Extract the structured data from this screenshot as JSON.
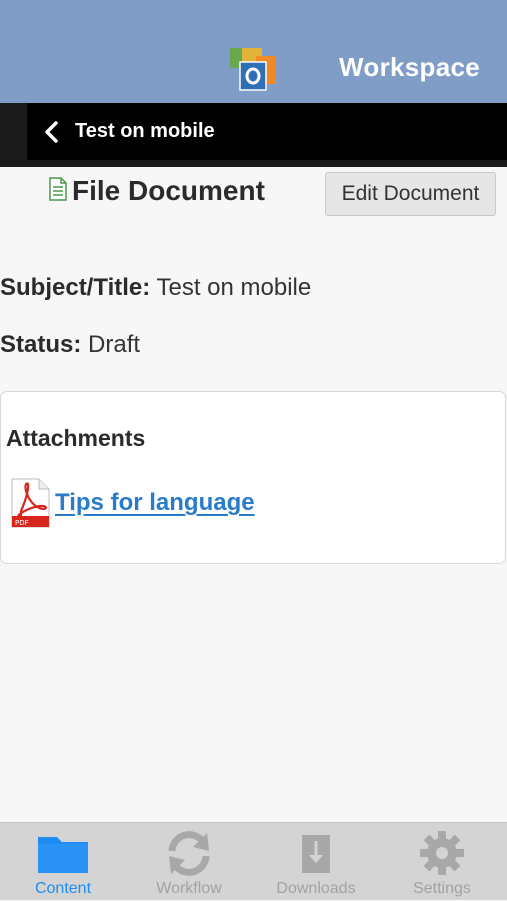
{
  "header": {
    "app_title": "Workspace",
    "logo_icon": "outlook-logo-icon",
    "background_color": "#7f9dc6"
  },
  "navbar": {
    "back_icon": "chevron-left-icon",
    "title": "Test on mobile"
  },
  "document": {
    "icon": "document-icon",
    "title": "File Document",
    "edit_button_label": "Edit Document",
    "fields": {
      "subject_label": "Subject/Title:",
      "subject_value": "Test on mobile",
      "status_label": "Status:",
      "status_value": "Draft"
    }
  },
  "attachments": {
    "heading": "Attachments",
    "items": [
      {
        "icon": "pdf-file-icon",
        "label": "Tips for language"
      }
    ]
  },
  "tabbar": {
    "active_color": "#1e8cf2",
    "inactive_color": "#a2a2a2",
    "tabs": [
      {
        "label": "Content",
        "icon": "folder-icon",
        "active": true
      },
      {
        "label": "Workflow",
        "icon": "refresh-icon",
        "active": false
      },
      {
        "label": "Downloads",
        "icon": "download-icon",
        "active": false
      },
      {
        "label": "Settings",
        "icon": "gear-icon",
        "active": false
      }
    ]
  }
}
